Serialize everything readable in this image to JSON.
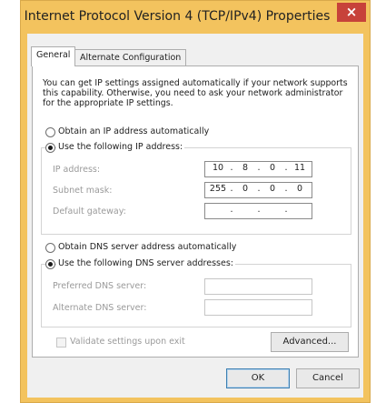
{
  "window": {
    "title": "Internet Protocol Version 4 (TCP/IPv4) Properties",
    "close_glyph": "×"
  },
  "tabs": [
    {
      "label": "General"
    },
    {
      "label": "Alternate Configuration"
    }
  ],
  "description": "You can get IP settings assigned automatically if your network supports this capability. Otherwise, you need to ask your network administrator for the appropriate IP settings.",
  "ip_mode": {
    "auto_label": "Obtain an IP address automatically",
    "manual_label": "Use the following IP address:",
    "selected": "manual"
  },
  "ip_fields": {
    "ip_label": "IP address:",
    "ip_value": [
      "10",
      "8",
      "0",
      "11"
    ],
    "subnet_label": "Subnet mask:",
    "subnet_value": [
      "255",
      "0",
      "0",
      "0"
    ],
    "gateway_label": "Default gateway:",
    "gateway_value": [
      "",
      "",
      "",
      ""
    ]
  },
  "dns_mode": {
    "auto_label": "Obtain DNS server address automatically",
    "manual_label": "Use the following DNS server addresses:",
    "selected": "manual"
  },
  "dns_fields": {
    "preferred_label": "Preferred DNS server:",
    "alternate_label": "Alternate DNS server:"
  },
  "validate": {
    "label": "Validate settings upon exit",
    "checked": false
  },
  "buttons": {
    "advanced": "Advanced...",
    "ok": "OK",
    "cancel": "Cancel"
  },
  "colors": {
    "titlebar": "#f3c35e",
    "close": "#c7423a",
    "panel": "#ffffff",
    "dialog_bg": "#f0f0f0"
  }
}
